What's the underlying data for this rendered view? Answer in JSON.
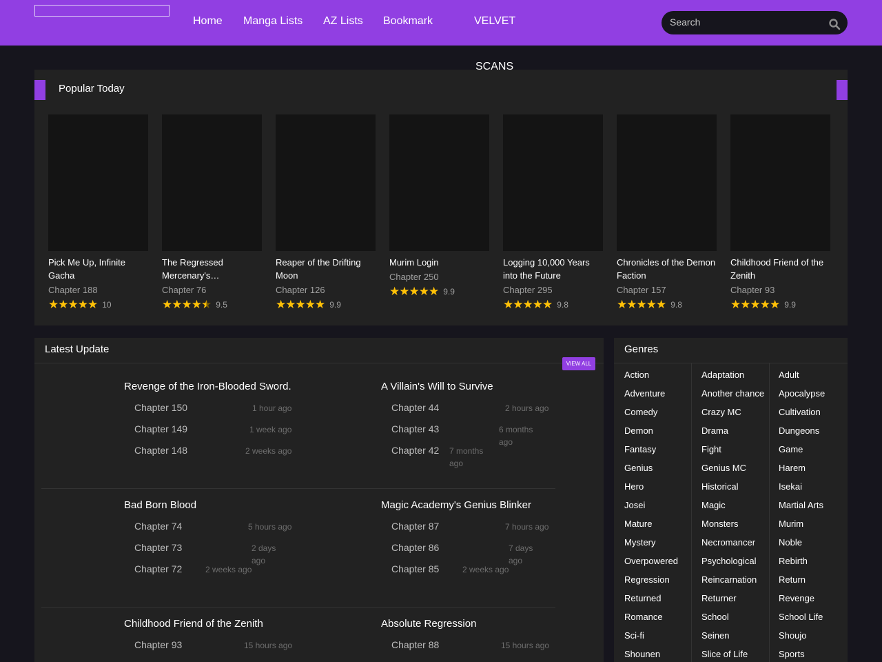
{
  "nav": {
    "items": [
      "Home",
      "Manga Lists",
      "AZ Lists",
      "Bookmark"
    ],
    "site_name_line1": "VELVET",
    "site_name_line2": "SCANS"
  },
  "search": {
    "placeholder": "Search"
  },
  "colors": {
    "accent": "#913fe2",
    "background": "#16151d",
    "panel": "#222222",
    "star": "#ffc107"
  },
  "popular": {
    "title": "Popular Today",
    "cards": [
      {
        "title": "Pick Me Up, Infinite Gacha",
        "chapter": "Chapter 188",
        "score": "10",
        "stars": 5
      },
      {
        "title": "The Regressed Mercenary's…",
        "chapter": "Chapter 76",
        "score": "9.5",
        "stars": 4.5
      },
      {
        "title": "Reaper of the Drifting Moon",
        "chapter": "Chapter 126",
        "score": "9.9",
        "stars": 5
      },
      {
        "title": "Murim Login",
        "chapter": "Chapter 250",
        "score": "9.9",
        "stars": 5
      },
      {
        "title": "Logging 10,000 Years into the Future",
        "chapter": "Chapter 295",
        "score": "9.8",
        "stars": 5
      },
      {
        "title": "Chronicles of the Demon Faction",
        "chapter": "Chapter 157",
        "score": "9.8",
        "stars": 5
      },
      {
        "title": "Childhood Friend of the Zenith",
        "chapter": "Chapter 93",
        "score": "9.9",
        "stars": 5
      }
    ]
  },
  "latest": {
    "title": "Latest Update",
    "view_all": "VIEW ALL",
    "entries": [
      {
        "title": "Revenge of the Iron-Blooded Sword.",
        "chapters": [
          {
            "label": "Chapter 150",
            "time": "1 hour ago"
          },
          {
            "label": "Chapter 149",
            "time": "1 week ago"
          },
          {
            "label": "Chapter 148",
            "time": "2 weeks ago"
          }
        ]
      },
      {
        "title": "A Villain's Will to Survive",
        "chapters": [
          {
            "label": "Chapter 44",
            "time": "2 hours ago"
          },
          {
            "label": "Chapter 43",
            "time": "6 months ago"
          },
          {
            "label": "Chapter 42",
            "time": "7 months ago"
          }
        ]
      },
      {
        "title": "Bad Born Blood",
        "chapters": [
          {
            "label": "Chapter 74",
            "time": "5 hours ago"
          },
          {
            "label": "Chapter 73",
            "time": "2 days ago"
          },
          {
            "label": "Chapter 72",
            "time": "2 weeks ago"
          }
        ]
      },
      {
        "title": "Magic Academy's Genius Blinker",
        "chapters": [
          {
            "label": "Chapter 87",
            "time": "7 hours ago"
          },
          {
            "label": "Chapter 86",
            "time": "7 days ago"
          },
          {
            "label": "Chapter 85",
            "time": "2 weeks ago"
          }
        ]
      },
      {
        "title": "Childhood Friend of the Zenith",
        "chapters": [
          {
            "label": "Chapter 93",
            "time": "15 hours ago"
          }
        ]
      },
      {
        "title": "Absolute Regression",
        "chapters": [
          {
            "label": "Chapter 88",
            "time": "15 hours ago"
          }
        ]
      }
    ]
  },
  "genres": {
    "title": "Genres",
    "items": [
      "Action",
      "Adaptation",
      "Adult",
      "Adventure",
      "Another chance",
      "Apocalypse",
      "Comedy",
      "Crazy MC",
      "Cultivation",
      "Demon",
      "Drama",
      "Dungeons",
      "Fantasy",
      "Fight",
      "Game",
      "Genius",
      "Genius MC",
      "Harem",
      "Hero",
      "Historical",
      "Isekai",
      "Josei",
      "Magic",
      "Martial Arts",
      "Mature",
      "Monsters",
      "Murim",
      "Mystery",
      "Necromancer",
      "Noble",
      "Overpowered",
      "Psychological",
      "Rebirth",
      "Regression",
      "Reincarnation",
      "Return",
      "Returned",
      "Returner",
      "Revenge",
      "Romance",
      "School",
      "School Life",
      "Sci-fi",
      "Seinen",
      "Shoujo",
      "Shounen",
      "Slice of Life",
      "Sports"
    ]
  }
}
